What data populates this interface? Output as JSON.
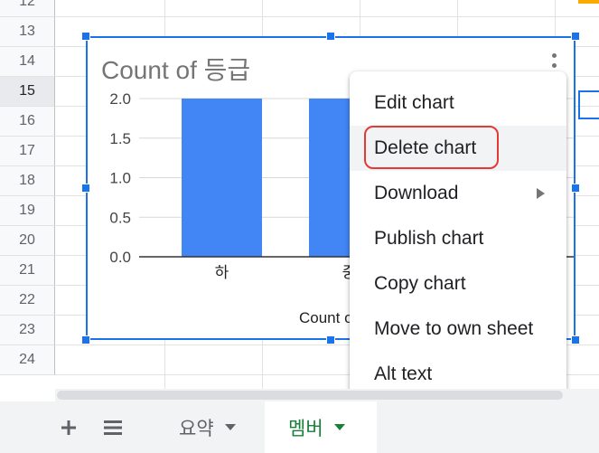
{
  "row_numbers": [
    "12",
    "13",
    "14",
    "15",
    "16",
    "17",
    "18",
    "19",
    "20",
    "21",
    "22",
    "23",
    "24"
  ],
  "selected_row": "15",
  "chart": {
    "menu_icon": "more-vert-icon",
    "chart_data": {
      "type": "bar",
      "title": "Count of 등급",
      "categories": [
        "하",
        "중"
      ],
      "values": [
        2,
        2
      ],
      "ylim": [
        0,
        2
      ],
      "y_ticks": [
        "2.0",
        "1.5",
        "1.0",
        "0.5",
        "0.0"
      ],
      "xlabel": "Count o",
      "grid": true,
      "bar_color": "#4285f4"
    }
  },
  "context_menu": {
    "items": [
      {
        "label": "Edit chart"
      },
      {
        "label": "Delete chart"
      },
      {
        "label": "Download",
        "submenu_icon": "triangle-right-icon"
      },
      {
        "label": "Publish chart"
      },
      {
        "label": "Copy chart"
      },
      {
        "label": "Move to own sheet"
      },
      {
        "label": "Alt text"
      }
    ]
  },
  "sheet_bar": {
    "add_icon": "plus-icon",
    "list_icon": "all-sheets-icon",
    "tabs": [
      {
        "label": "요약",
        "active": false
      },
      {
        "label": "멤버",
        "active": true
      }
    ]
  },
  "colors": {
    "selection_blue": "#1a73e8",
    "highlight_red": "#e53935",
    "active_tab_green": "#188038"
  }
}
